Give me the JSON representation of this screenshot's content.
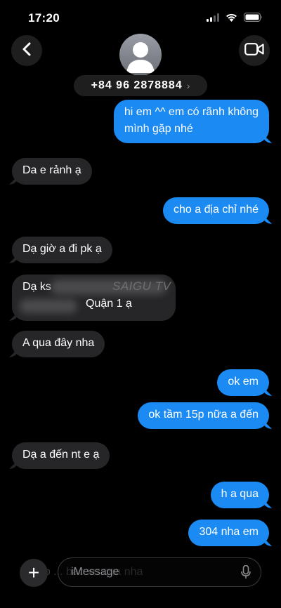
{
  "status_bar": {
    "time": "17:20",
    "icons": [
      "cellular-signal-icon",
      "wifi-icon",
      "battery-icon"
    ]
  },
  "header": {
    "contact_number": "+84 96 2878884",
    "contact_chevron": "›",
    "icons": [
      "back-chevron-icon",
      "video-call-icon",
      "person-icon"
    ]
  },
  "messages": [
    {
      "dir": "out",
      "lines": [
        "hi em ^^ em có rãnh không",
        "mình gặp nhé"
      ]
    },
    {
      "dir": "in",
      "lines": [
        "Da e rảnh ạ"
      ]
    },
    {
      "dir": "out",
      "lines": [
        "cho a địa chỉ nhé"
      ]
    },
    {
      "dir": "in",
      "lines": [
        "Dạ giờ a đi pk ạ"
      ]
    },
    {
      "dir": "in",
      "lines": [
        "Dạ ks",
        "Quận 1 ạ"
      ]
    },
    {
      "dir": "in",
      "lines": [
        "A qua đây nha"
      ]
    },
    {
      "dir": "out",
      "lines": [
        "ok em"
      ]
    },
    {
      "dir": "out",
      "lines": [
        "ok tầm 15p nữa a đến"
      ]
    },
    {
      "dir": "in",
      "lines": [
        "Dạ a đến nt e ạ"
      ]
    },
    {
      "dir": "out",
      "lines": [
        "h a qua"
      ]
    },
    {
      "dir": "out",
      "lines": [
        "304 nha em"
      ]
    }
  ],
  "watermark": "SAIGU TV",
  "faded_message": "Dạ co ... bác xe qua nha",
  "composer": {
    "placeholder": "iMessage",
    "plus_label": "+",
    "icons": [
      "plus-icon",
      "microphone-icon"
    ]
  },
  "colors": {
    "background": "#000000",
    "incoming_bubble": "#262628",
    "outgoing_bubble": "#1b8af3"
  }
}
